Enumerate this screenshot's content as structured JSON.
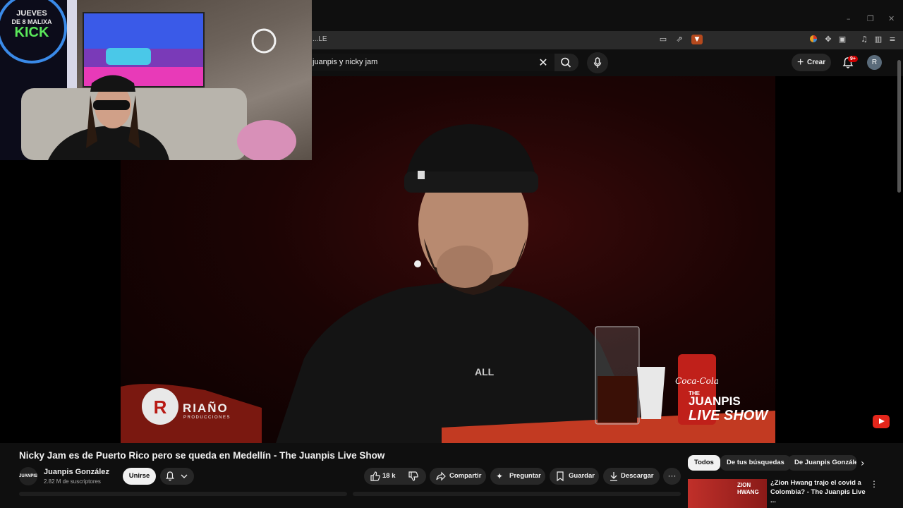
{
  "browser": {
    "url": "...LE",
    "window_controls": [
      "–",
      "❐",
      "✕"
    ]
  },
  "header": {
    "search_value": "juanpis y nicky jam",
    "create_label": "Crear",
    "notifications_badge": "9+",
    "user_initial": "R"
  },
  "webcam": {
    "sign_lines": [
      "JUEVES",
      "DE 8 MALIXA",
      "KICK"
    ]
  },
  "video": {
    "riano_name": "RIAÑO",
    "riano_sub": "PRODUCCIONES",
    "show_logo_line1": "THE",
    "show_logo_line2": "JUANPIS",
    "show_logo_line3": "LIVE SHOW",
    "cup_brand": "Coca-Cola",
    "hoodie_text": "ALL"
  },
  "below": {
    "title": "Nicky Jam es de Puerto Rico pero se queda en Medellín - The Juanpis Live Show",
    "channel_avatar": "JUANPIS",
    "channel_name": "Juanpis González",
    "subscribers": "2.82 M de suscriptores",
    "join_label": "Unirse",
    "likes": "18 k",
    "share_label": "Compartir",
    "ask_label": "Preguntar",
    "save_label": "Guardar",
    "download_label": "Descargar",
    "more": "···"
  },
  "chips": [
    "Todos",
    "De tus búsquedas",
    "De Juanpis Gonzále"
  ],
  "recommendation": {
    "title_line1": "¿Zion Hwang trajo el covid a",
    "title_line2": "Colombia? - The Juanpis Live ...",
    "thumb_text": "ZION HWANG"
  },
  "colors": {
    "accent_red": "#e4261b",
    "background": "#0f0f0f",
    "pill": "#272727"
  }
}
